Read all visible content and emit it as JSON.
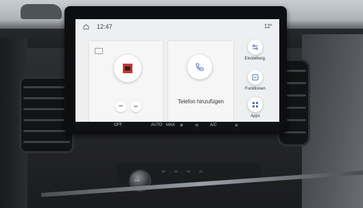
{
  "status_bar": {
    "time": "12:47",
    "temperature": "12°"
  },
  "phone_card": {
    "label": "Telefon hinzufügen"
  },
  "side_buttons": [
    {
      "label": "Einstellung.",
      "icon": "settings-sliders-icon"
    },
    {
      "label": "Funktionen",
      "icon": "functions-icon"
    },
    {
      "label": "Apps",
      "icon": "apps-grid-icon"
    }
  ],
  "climate": {
    "fan": "OFF",
    "auto": "AUTO",
    "max_front": "MAX",
    "ac": "A/C"
  },
  "media": {
    "prev": "⏮",
    "next": "⏭"
  },
  "physical": {
    "knob_label": "VOL"
  },
  "colors": {
    "screen_bg": "#eeeff0",
    "album_accent": "#c23a2e"
  }
}
